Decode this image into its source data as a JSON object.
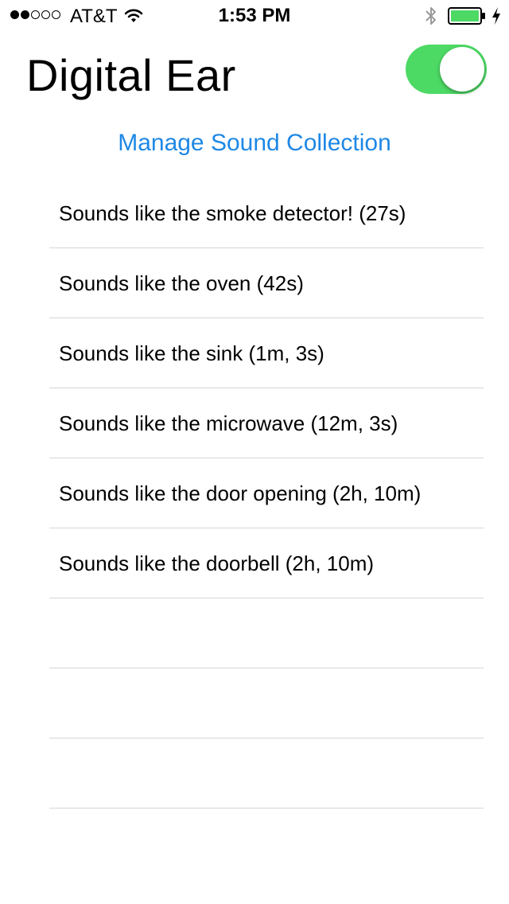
{
  "status_bar": {
    "signal_dots_filled": 2,
    "signal_dots_total": 5,
    "carrier": "AT&T",
    "time": "1:53 PM",
    "battery_level": 1.0,
    "battery_color": "#4cd964",
    "icons": [
      "wifi-icon",
      "bluetooth-icon",
      "battery-icon",
      "charging-icon"
    ]
  },
  "header": {
    "title": "Digital Ear",
    "toggle_on": true,
    "toggle_color": "#4cd964"
  },
  "manage_link": {
    "label": "Manage Sound Collection",
    "color": "#1e88e5"
  },
  "sounds": [
    {
      "label": "Sounds like the smoke detector! (27s)"
    },
    {
      "label": "Sounds like the oven (42s)"
    },
    {
      "label": "Sounds like the sink (1m, 3s)"
    },
    {
      "label": "Sounds like the microwave (12m, 3s)"
    },
    {
      "label": "Sounds like the door opening (2h, 10m)"
    },
    {
      "label": "Sounds like the doorbell (2h, 10m)"
    },
    {
      "label": ""
    },
    {
      "label": ""
    },
    {
      "label": ""
    }
  ]
}
